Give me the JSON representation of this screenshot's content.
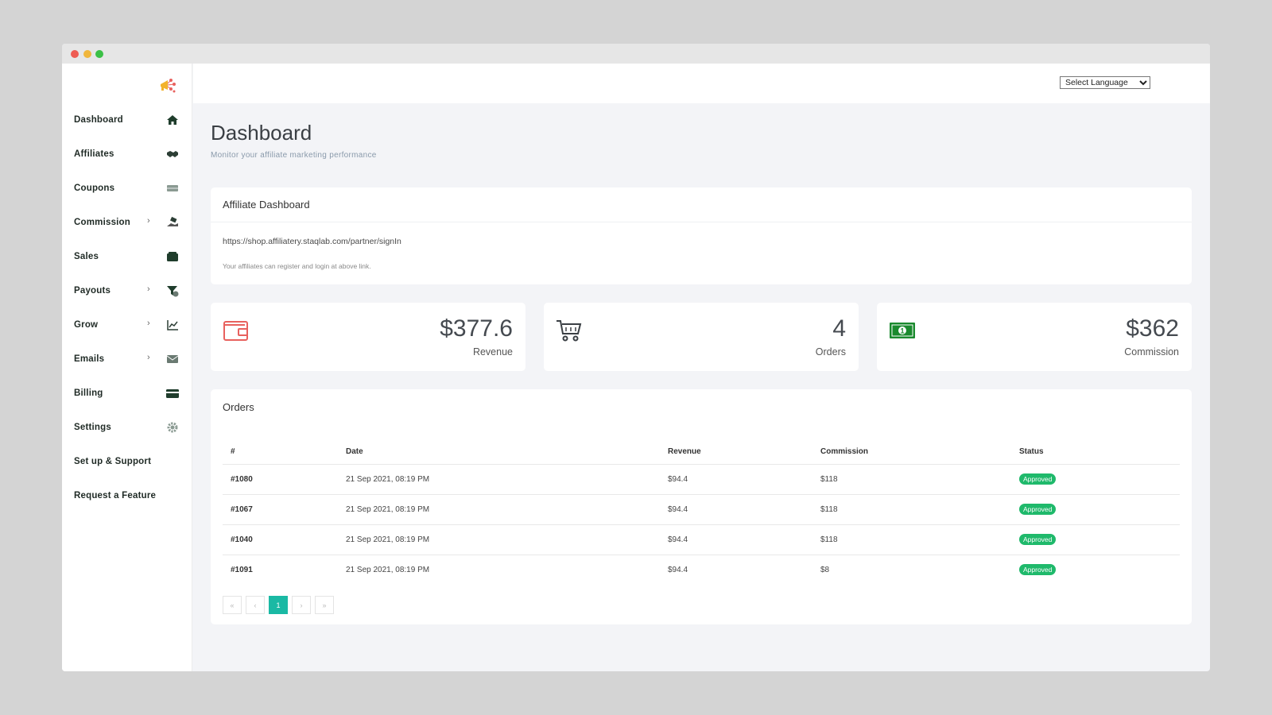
{
  "sidebar": {
    "items": [
      {
        "label": "Dashboard",
        "icon": "home-icon",
        "chevron": ""
      },
      {
        "label": "Affiliates",
        "icon": "handshake-icon",
        "chevron": ""
      },
      {
        "label": "Coupons",
        "icon": "ticket-icon",
        "chevron": ""
      },
      {
        "label": "Commission",
        "icon": "money-hand-icon",
        "chevron": "›"
      },
      {
        "label": "Sales",
        "icon": "wallet-icon",
        "chevron": ""
      },
      {
        "label": "Payouts",
        "icon": "funnel-dollar-icon",
        "chevron": "›"
      },
      {
        "label": "Grow",
        "icon": "chart-line-icon",
        "chevron": "›"
      },
      {
        "label": "Emails",
        "icon": "envelope-icon",
        "chevron": "›"
      },
      {
        "label": "Billing",
        "icon": "credit-card-icon",
        "chevron": ""
      },
      {
        "label": "Settings",
        "icon": "gear-icon",
        "chevron": ""
      },
      {
        "label": "Set up & Support",
        "icon": "",
        "chevron": ""
      },
      {
        "label": "Request a Feature",
        "icon": "",
        "chevron": ""
      }
    ]
  },
  "topbar": {
    "language_select": "Select Language"
  },
  "page": {
    "title": "Dashboard",
    "subtitle": "Monitor your affiliate marketing performance"
  },
  "affiliate_card": {
    "title": "Affiliate Dashboard",
    "link": "https://shop.affiliatery.staqlab.com/partner/signIn",
    "note": "Your affiliates can register and login at above link."
  },
  "stats": [
    {
      "value": "$377.6",
      "label": "Revenue",
      "icon": "wallet-icon",
      "color": "#e8615e"
    },
    {
      "value": "4",
      "label": "Orders",
      "icon": "cart-icon",
      "color": "#3a3f44"
    },
    {
      "value": "$362",
      "label": "Commission",
      "icon": "banknote-icon",
      "color": "#1a8a2e"
    }
  ],
  "orders": {
    "title": "Orders",
    "columns": [
      "#",
      "Date",
      "Revenue",
      "Commission",
      "Status"
    ],
    "rows": [
      {
        "id": "#1080",
        "date": "21 Sep 2021, 08:19 PM",
        "revenue": "$94.4",
        "commission": "$118",
        "status": "Approved"
      },
      {
        "id": "#1067",
        "date": "21 Sep 2021, 08:19 PM",
        "revenue": "$94.4",
        "commission": "$118",
        "status": "Approved"
      },
      {
        "id": "#1040",
        "date": "21 Sep 2021, 08:19 PM",
        "revenue": "$94.4",
        "commission": "$118",
        "status": "Approved"
      },
      {
        "id": "#1091",
        "date": "21 Sep 2021, 08:19 PM",
        "revenue": "$94.4",
        "commission": "$8",
        "status": "Approved"
      }
    ],
    "pagination": {
      "first": "«",
      "prev": "‹",
      "current": "1",
      "next": "›",
      "last": "»"
    }
  },
  "colors": {
    "accent": "#1ab9a4",
    "approved": "#1fb96b",
    "sidebar_text": "#1f2a25"
  }
}
